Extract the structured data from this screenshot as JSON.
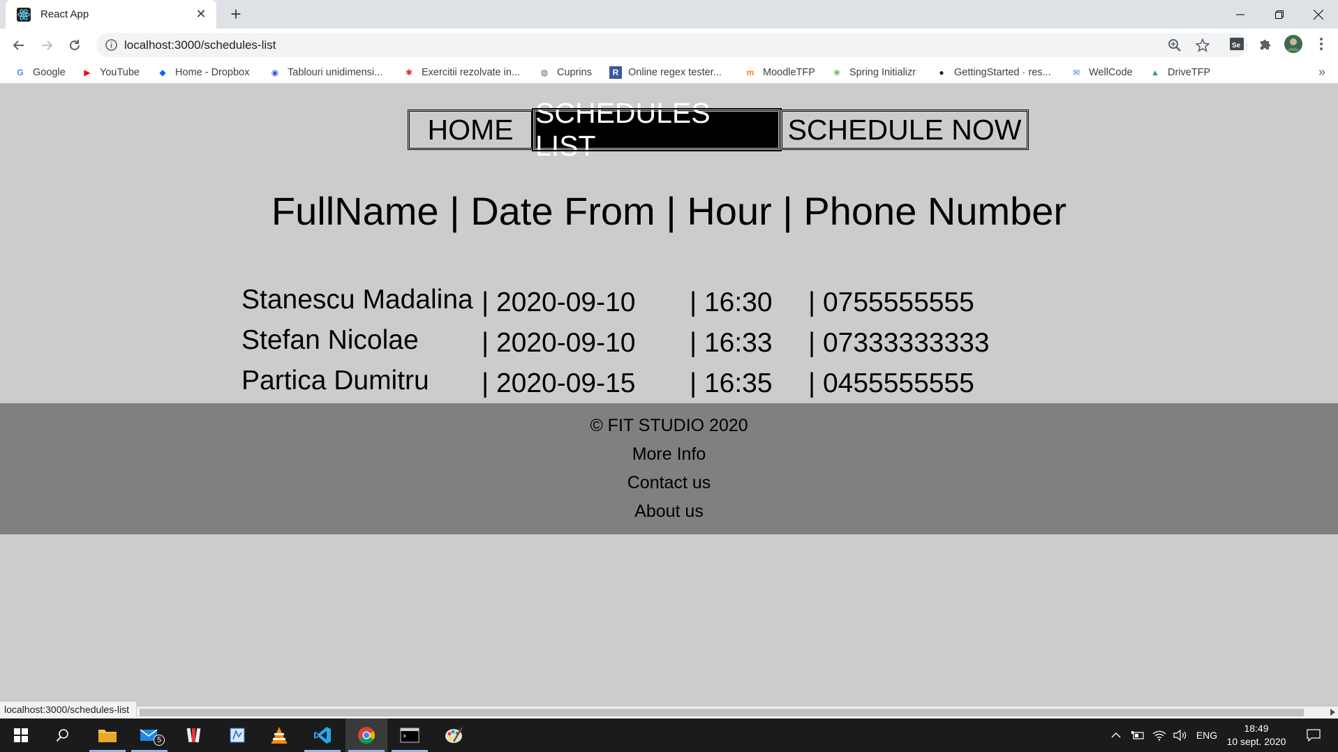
{
  "browser": {
    "tab_title": "React App",
    "url": "localhost:3000/schedules-list",
    "status_url": "localhost:3000/schedules-list"
  },
  "bookmarks": [
    {
      "label": "Google",
      "icon": "google-icon",
      "color": "#4285f4"
    },
    {
      "label": "YouTube",
      "icon": "youtube-icon",
      "color": "#ff0000"
    },
    {
      "label": "Home - Dropbox",
      "icon": "dropbox-icon",
      "color": "#0061fe"
    },
    {
      "label": "Tablouri unidimensi...",
      "icon": "globe-blue-icon",
      "color": "#3b5bdb"
    },
    {
      "label": "Exercitii rezolvate in...",
      "icon": "asterisk-icon",
      "color": "#e03131"
    },
    {
      "label": "Cuprins",
      "icon": "globe-icon",
      "color": "#5f6368"
    },
    {
      "label": "Online regex tester...",
      "icon": "r-icon",
      "color": "#3b5998"
    },
    {
      "label": "MoodleTFP",
      "icon": "moodle-icon",
      "color": "#f98012"
    },
    {
      "label": "Spring Initializr",
      "icon": "spring-icon",
      "color": "#6db33f"
    },
    {
      "label": "GettingStarted · res...",
      "icon": "github-icon",
      "color": "#202124"
    },
    {
      "label": "WellCode",
      "icon": "wellcode-icon",
      "color": "#4c6ef5"
    },
    {
      "label": "DriveTFP",
      "icon": "drive-icon",
      "color": "#1fa463"
    }
  ],
  "nav": {
    "home": "HOME",
    "schedules_list": "SCHEDULES LIST",
    "schedule_now": "SCHEDULE NOW"
  },
  "table": {
    "header": "FullName | Date From | Hour | Phone Number",
    "rows": [
      {
        "name": "Stanescu Madalina",
        "date": "| 2020-09-10",
        "hour": "| 16:30",
        "phone": "| 0755555555"
      },
      {
        "name": "Stefan Nicolae",
        "date": "| 2020-09-10",
        "hour": "| 16:33",
        "phone": "| 07333333333"
      },
      {
        "name": "Partica Dumitru",
        "date": "| 2020-09-15",
        "hour": "| 16:35",
        "phone": "| 0455555555"
      }
    ]
  },
  "footer": {
    "copyright": "© FIT STUDIO 2020",
    "more_info": "More Info",
    "contact": "Contact us",
    "about": "About us"
  },
  "taskbar": {
    "mail_badge": "5",
    "language": "ENG",
    "time": "18:49",
    "date": "10 sept. 2020"
  }
}
